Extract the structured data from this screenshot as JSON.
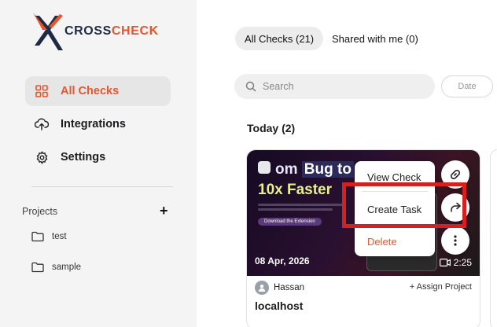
{
  "brand": {
    "part1": "CROSS",
    "part2": "CHECK",
    "accent": "#e8542c",
    "dark": "#1f2a44"
  },
  "sidebar": {
    "items": [
      {
        "label": "All Checks",
        "icon": "grid-icon",
        "active": true
      },
      {
        "label": "Integrations",
        "icon": "cloud-upload-icon",
        "active": false
      },
      {
        "label": "Settings",
        "icon": "gear-icon",
        "active": false
      }
    ],
    "projects_label": "Projects",
    "add_icon": "+",
    "projects": [
      {
        "name": "test"
      },
      {
        "name": "sample"
      }
    ]
  },
  "tabs": [
    {
      "label": "All Checks (21)",
      "active": true
    },
    {
      "label": "Shared with me (0)",
      "active": false
    }
  ],
  "search": {
    "placeholder": "Search"
  },
  "date_filter": {
    "label": "Date"
  },
  "section": {
    "title": "Today (2)"
  },
  "card": {
    "thumb_word1": "om",
    "thumb_word2": "Bug to",
    "thumb_line2": "10x Faster",
    "thumb_button": "Download the Extension",
    "date": "08 Apr, 2026",
    "duration": "2:25",
    "user": "Hassan",
    "assign": "+ Assign Project",
    "title": "localhost"
  },
  "context_menu": {
    "view": "View Check",
    "create": "Create Task",
    "delete": "Delete"
  },
  "highlight_color": "#d62020"
}
